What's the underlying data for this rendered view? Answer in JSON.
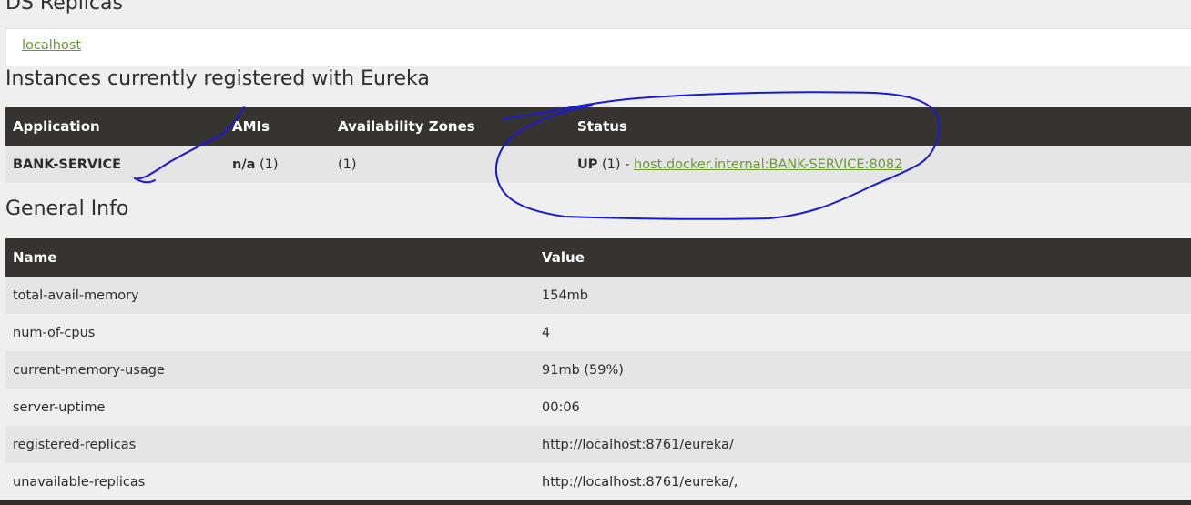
{
  "ds_replicas": {
    "title": "DS Replicas",
    "link": "localhost"
  },
  "instances": {
    "title": "Instances currently registered with Eureka",
    "headers": [
      "Application",
      "AMIs",
      "Availability Zones",
      "Status"
    ],
    "rows": [
      {
        "application": "BANK-SERVICE",
        "amis_value": "n/a",
        "amis_count": "(1)",
        "zones": "(1)",
        "status_state": "UP",
        "status_count": "(1) -",
        "status_link": "host.docker.internal:BANK-SERVICE:8082"
      }
    ]
  },
  "general_info": {
    "title": "General Info",
    "headers": [
      "Name",
      "Value"
    ],
    "rows": [
      {
        "name": "total-avail-memory",
        "value": "154mb"
      },
      {
        "name": "num-of-cpus",
        "value": "4"
      },
      {
        "name": "current-memory-usage",
        "value": "91mb (59%)"
      },
      {
        "name": "server-uptime",
        "value": "00:06"
      },
      {
        "name": "registered-replicas",
        "value": "http://localhost:8761/eureka/"
      },
      {
        "name": "unavailable-replicas",
        "value": "http://localhost:8761/eureka/,"
      }
    ]
  },
  "colors": {
    "header_bg": "#363330",
    "link": "#6a9a2e",
    "annotation_ink": "#1a1ad6"
  }
}
